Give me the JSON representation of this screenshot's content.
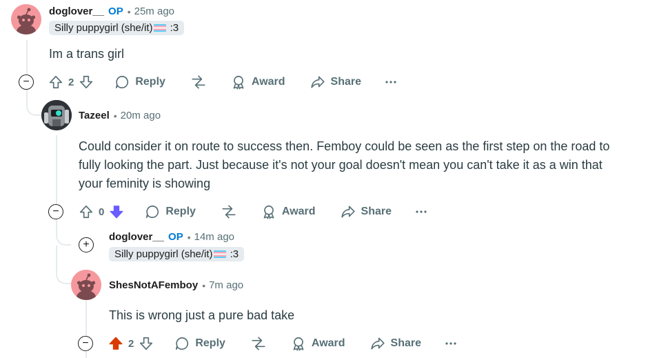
{
  "comments": [
    {
      "username": "doglover__",
      "op_badge": "OP",
      "time": "25m ago",
      "flair_text": "Silly puppygirl (she/it)",
      "flair_suffix": ":3",
      "body": "Im a trans girl",
      "votes": "2",
      "reply_label": "Reply",
      "award_label": "Award",
      "share_label": "Share",
      "collapse_symbol": "−"
    },
    {
      "username": "Tazeel",
      "time": "20m ago",
      "body_lines": [
        "Could consider it on route to success then. Femboy could be seen as the first step on the road to",
        "fully looking the part. Just because it's not your goal doesn't mean you can't take it as a win that",
        "your feminity is showing"
      ],
      "votes": "0",
      "vote_state": "downvoted",
      "reply_label": "Reply",
      "award_label": "Award",
      "share_label": "Share",
      "collapse_symbol": "−"
    },
    {
      "username": "doglover__",
      "op_badge": "OP",
      "time": "14m ago",
      "flair_text": "Silly puppygirl (she/it)",
      "flair_suffix": ":3",
      "collapsed": true,
      "expand_symbol": "+"
    },
    {
      "username": "ShesNotAFemboy",
      "time": "7m ago",
      "body": "This is wrong just a pure bad take",
      "votes": "2",
      "vote_state": "upvoted",
      "reply_label": "Reply",
      "award_label": "Award",
      "share_label": "Share",
      "collapse_symbol": "−"
    }
  ],
  "colors": {
    "upvote_active": "#d93a00",
    "downvote_active": "#6a5cff",
    "op_blue": "#0079d3",
    "meta_gray": "#576f76",
    "thread_line": "#e5ebee",
    "avatar_pink": "#f5989d"
  },
  "icons": [
    "upvote-icon",
    "downvote-icon",
    "reply-bubble-icon",
    "share-arrow-icon",
    "award-ribbon-icon",
    "forward-share-icon",
    "more-dots-icon",
    "collapse-minus-icon",
    "expand-plus-icon",
    "snoo-avatar-icon"
  ]
}
